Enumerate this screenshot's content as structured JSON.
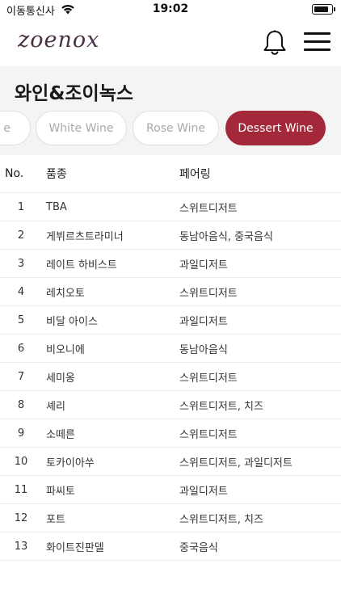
{
  "status_bar": {
    "carrier": "이동통신사",
    "time": "19:02"
  },
  "header": {
    "logo_text": "zoenox"
  },
  "category": {
    "title": "와인&조이녹스",
    "chips": [
      {
        "label": "e",
        "active": false
      },
      {
        "label": "White Wine",
        "active": false
      },
      {
        "label": "Rose Wine",
        "active": false
      },
      {
        "label": "Dessert Wine",
        "active": true
      }
    ]
  },
  "table": {
    "headers": {
      "no": "No.",
      "name": "품종",
      "pairing": "페어링"
    },
    "rows": [
      {
        "no": "1",
        "name": "TBA",
        "pairing": "스위트디저트"
      },
      {
        "no": "2",
        "name": "게뷔르츠트라미너",
        "pairing": "동남아음식, 중국음식"
      },
      {
        "no": "3",
        "name": "레이트 하비스트",
        "pairing": "과일디저트"
      },
      {
        "no": "4",
        "name": "레치오토",
        "pairing": "스위트디저트"
      },
      {
        "no": "5",
        "name": "비달 아이스",
        "pairing": "과일디저트"
      },
      {
        "no": "6",
        "name": "비오니에",
        "pairing": "동남아음식"
      },
      {
        "no": "7",
        "name": "세미옹",
        "pairing": "스위트디저트"
      },
      {
        "no": "8",
        "name": "셰리",
        "pairing": "스위트디저트, 치즈"
      },
      {
        "no": "9",
        "name": "소떼른",
        "pairing": "스위트디저트"
      },
      {
        "no": "10",
        "name": "토카이아쑤",
        "pairing": "스위트디저트, 과일디저트"
      },
      {
        "no": "11",
        "name": "파씨토",
        "pairing": "과일디저트"
      },
      {
        "no": "12",
        "name": "포트",
        "pairing": "스위트디저트, 치즈"
      },
      {
        "no": "13",
        "name": "화이트진판델",
        "pairing": "중국음식"
      }
    ]
  },
  "colors": {
    "accent": "#a3283a",
    "logo": "#4a3146",
    "category_bg": "#f4f4f4"
  },
  "icons": [
    "wifi-icon",
    "battery-icon",
    "bell-icon",
    "hamburger-menu-icon"
  ]
}
